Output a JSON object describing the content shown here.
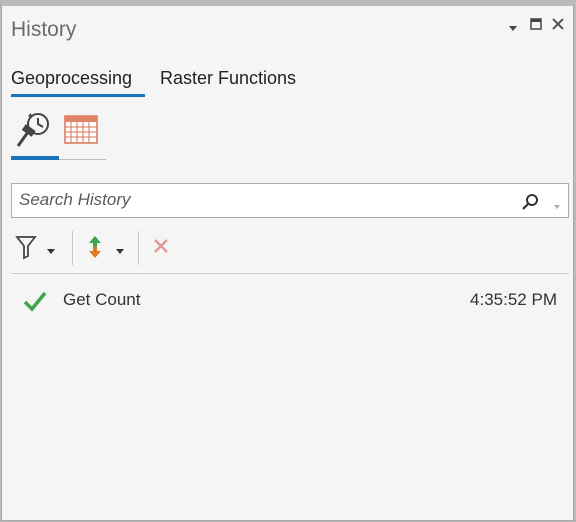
{
  "panel": {
    "title": "History"
  },
  "tabs": [
    {
      "label": "Geoprocessing",
      "active": true
    },
    {
      "label": "Raster Functions",
      "active": false
    }
  ],
  "subtabs": [
    {
      "icon": "history-hammer-icon",
      "active": true
    },
    {
      "icon": "calendar-icon",
      "active": false
    }
  ],
  "search": {
    "placeholder": "Search History",
    "value": ""
  },
  "toolbar": {
    "filter_icon": "filter-icon",
    "sort_icon": "sort-icon",
    "remove_icon": "remove-icon"
  },
  "history": [
    {
      "status": "success",
      "name": "Get Count",
      "time": "4:35:52 PM"
    }
  ],
  "colors": {
    "accent": "#1b75bb",
    "success": "#3fa34d",
    "sort_up": "#3fa34d",
    "sort_down": "#e07a1f",
    "remove": "#e39a98"
  }
}
